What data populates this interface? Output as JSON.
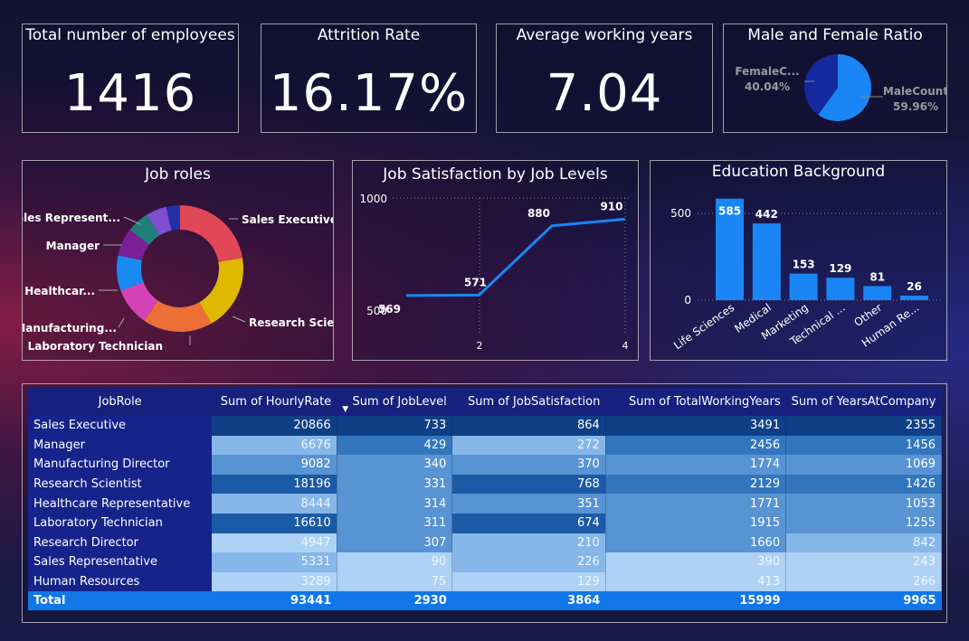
{
  "kpis": [
    {
      "title": "Total number of employees",
      "value": "1416"
    },
    {
      "title": "Attrition Rate",
      "value": "16.17%"
    },
    {
      "title": "Average working years",
      "value": "7.04"
    }
  ],
  "gender": {
    "title": "Male and Female Ratio",
    "female_label": "FemaleC...",
    "female_pct": "40.04%",
    "female_value": 40.04,
    "male_label": "MaleCount",
    "male_pct": "59.96%",
    "male_value": 59.96,
    "female_color": "#142a9e",
    "male_color": "#1a86f5"
  },
  "job_roles": {
    "title": "Job roles",
    "slices": [
      {
        "label": "Sales Executive",
        "value": 20866,
        "color": "#e04858"
      },
      {
        "label": "Research Scie...",
        "value": 18196,
        "color": "#dfb800"
      },
      {
        "label": "Laboratory Technician",
        "value": 16610,
        "color": "#ec6f36"
      },
      {
        "label": "Manufacturing...",
        "value": 9082,
        "color": "#d542b5"
      },
      {
        "label": "Healthcar...",
        "value": 8444,
        "color": "#1a8af0"
      },
      {
        "label": "Manager",
        "value": 6676,
        "color": "#7b1f96"
      },
      {
        "label": "Sales Represent...",
        "value": 5331,
        "color": "#1e7f7a"
      },
      {
        "label": "",
        "value": 4947,
        "color": "#7d4fd0"
      },
      {
        "label": "",
        "value": 3289,
        "color": "#2231a6"
      }
    ]
  },
  "satisfaction": {
    "title": "Job Satisfaction by Job Levels",
    "x": [
      1,
      2,
      3,
      4
    ],
    "y": [
      569,
      571,
      880,
      910
    ],
    "y_ticks": [
      "1000",
      "500"
    ],
    "x_ticks": [
      "2",
      "4"
    ],
    "color": "#1a86f5"
  },
  "education": {
    "title": "Education Background",
    "categories": [
      "Life Sciences",
      "Medical",
      "Marketing",
      "Technical ...",
      "Other",
      "Human Re..."
    ],
    "values": [
      585,
      442,
      153,
      129,
      81,
      26
    ],
    "y_ticks": [
      "500",
      "0"
    ],
    "color": "#1a86f5"
  },
  "table": {
    "headers": [
      "JobRole",
      "Sum of HourlyRate",
      "Sum of JobLevel",
      "Sum of JobSatisfaction",
      "Sum of TotalWorkingYears",
      "Sum of YearsAtCompany"
    ],
    "sort_indicator": "▼",
    "rows": [
      [
        "Sales Executive",
        "20866",
        "733",
        "864",
        "3491",
        "2355"
      ],
      [
        "Manager",
        "6676",
        "429",
        "272",
        "2456",
        "1456"
      ],
      [
        "Manufacturing Director",
        "9082",
        "340",
        "370",
        "1774",
        "1069"
      ],
      [
        "Research Scientist",
        "18196",
        "331",
        "768",
        "2129",
        "1426"
      ],
      [
        "Healthcare Representative",
        "8444",
        "314",
        "351",
        "1771",
        "1053"
      ],
      [
        "Laboratory Technician",
        "16610",
        "311",
        "674",
        "1915",
        "1255"
      ],
      [
        "Research Director",
        "4947",
        "307",
        "210",
        "1660",
        "842"
      ],
      [
        "Sales Representative",
        "5331",
        "90",
        "226",
        "390",
        "243"
      ],
      [
        "Human Resources",
        "3289",
        "75",
        "129",
        "413",
        "266"
      ]
    ],
    "total": [
      "Total",
      "93441",
      "2930",
      "3864",
      "15999",
      "9965"
    ]
  }
}
